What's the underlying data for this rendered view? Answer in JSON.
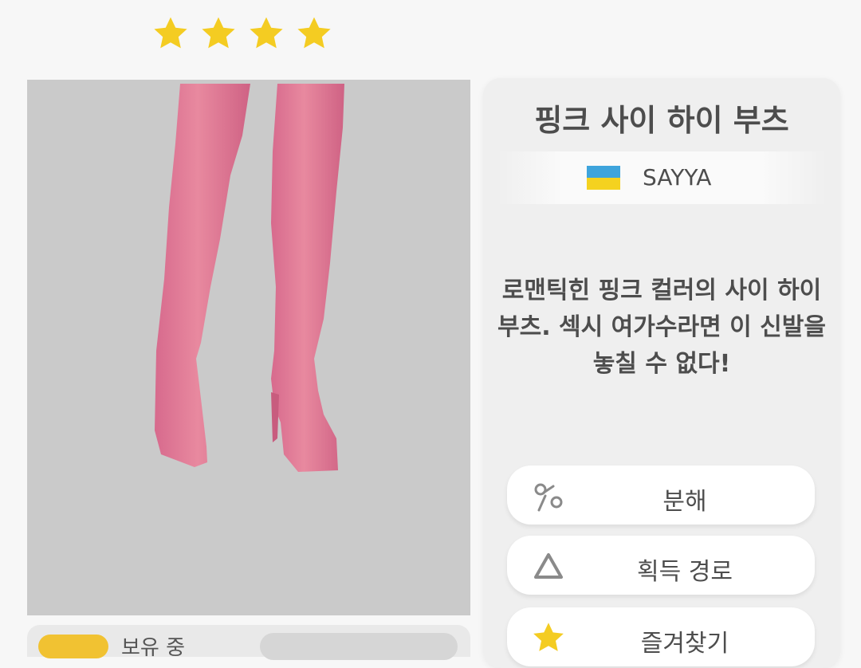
{
  "rating": {
    "stars": 4,
    "star_color": "#f4cc22"
  },
  "item": {
    "name": "핑크 사이 하이 부츠",
    "brand": "SAYYA",
    "brand_flag_colors": [
      "#3ea4dc",
      "#f4d21f"
    ],
    "description": "로맨틱힌 핑크 컬러의 사이 하이 부츠. 섹시 여가수라면 이 신발을 놓칠 수 없다!",
    "color": "#e07c9d"
  },
  "owned": {
    "label": "보유 중"
  },
  "actions": {
    "disassemble": {
      "label": "분해",
      "icon": "scissors-icon"
    },
    "acquire": {
      "label": "획득 경로",
      "icon": "triangle-icon"
    },
    "favorite": {
      "label": "즐겨찾기",
      "icon": "star-icon"
    }
  }
}
